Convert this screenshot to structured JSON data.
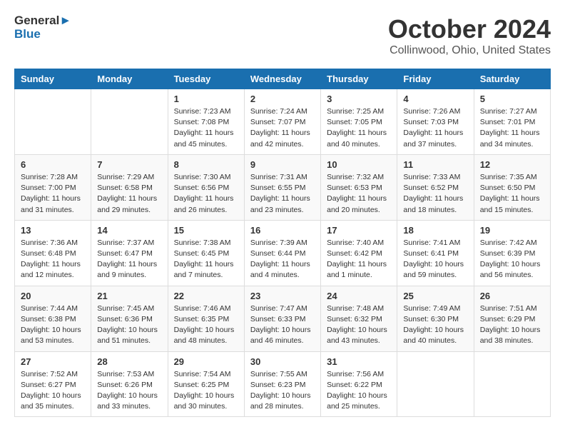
{
  "logo": {
    "line1": "General",
    "line2": "Blue"
  },
  "title": "October 2024",
  "location": "Collinwood, Ohio, United States",
  "headers": [
    "Sunday",
    "Monday",
    "Tuesday",
    "Wednesday",
    "Thursday",
    "Friday",
    "Saturday"
  ],
  "weeks": [
    [
      {
        "day": "",
        "info": ""
      },
      {
        "day": "",
        "info": ""
      },
      {
        "day": "1",
        "info": "Sunrise: 7:23 AM\nSunset: 7:08 PM\nDaylight: 11 hours\nand 45 minutes."
      },
      {
        "day": "2",
        "info": "Sunrise: 7:24 AM\nSunset: 7:07 PM\nDaylight: 11 hours\nand 42 minutes."
      },
      {
        "day": "3",
        "info": "Sunrise: 7:25 AM\nSunset: 7:05 PM\nDaylight: 11 hours\nand 40 minutes."
      },
      {
        "day": "4",
        "info": "Sunrise: 7:26 AM\nSunset: 7:03 PM\nDaylight: 11 hours\nand 37 minutes."
      },
      {
        "day": "5",
        "info": "Sunrise: 7:27 AM\nSunset: 7:01 PM\nDaylight: 11 hours\nand 34 minutes."
      }
    ],
    [
      {
        "day": "6",
        "info": "Sunrise: 7:28 AM\nSunset: 7:00 PM\nDaylight: 11 hours\nand 31 minutes."
      },
      {
        "day": "7",
        "info": "Sunrise: 7:29 AM\nSunset: 6:58 PM\nDaylight: 11 hours\nand 29 minutes."
      },
      {
        "day": "8",
        "info": "Sunrise: 7:30 AM\nSunset: 6:56 PM\nDaylight: 11 hours\nand 26 minutes."
      },
      {
        "day": "9",
        "info": "Sunrise: 7:31 AM\nSunset: 6:55 PM\nDaylight: 11 hours\nand 23 minutes."
      },
      {
        "day": "10",
        "info": "Sunrise: 7:32 AM\nSunset: 6:53 PM\nDaylight: 11 hours\nand 20 minutes."
      },
      {
        "day": "11",
        "info": "Sunrise: 7:33 AM\nSunset: 6:52 PM\nDaylight: 11 hours\nand 18 minutes."
      },
      {
        "day": "12",
        "info": "Sunrise: 7:35 AM\nSunset: 6:50 PM\nDaylight: 11 hours\nand 15 minutes."
      }
    ],
    [
      {
        "day": "13",
        "info": "Sunrise: 7:36 AM\nSunset: 6:48 PM\nDaylight: 11 hours\nand 12 minutes."
      },
      {
        "day": "14",
        "info": "Sunrise: 7:37 AM\nSunset: 6:47 PM\nDaylight: 11 hours\nand 9 minutes."
      },
      {
        "day": "15",
        "info": "Sunrise: 7:38 AM\nSunset: 6:45 PM\nDaylight: 11 hours\nand 7 minutes."
      },
      {
        "day": "16",
        "info": "Sunrise: 7:39 AM\nSunset: 6:44 PM\nDaylight: 11 hours\nand 4 minutes."
      },
      {
        "day": "17",
        "info": "Sunrise: 7:40 AM\nSunset: 6:42 PM\nDaylight: 11 hours\nand 1 minute."
      },
      {
        "day": "18",
        "info": "Sunrise: 7:41 AM\nSunset: 6:41 PM\nDaylight: 10 hours\nand 59 minutes."
      },
      {
        "day": "19",
        "info": "Sunrise: 7:42 AM\nSunset: 6:39 PM\nDaylight: 10 hours\nand 56 minutes."
      }
    ],
    [
      {
        "day": "20",
        "info": "Sunrise: 7:44 AM\nSunset: 6:38 PM\nDaylight: 10 hours\nand 53 minutes."
      },
      {
        "day": "21",
        "info": "Sunrise: 7:45 AM\nSunset: 6:36 PM\nDaylight: 10 hours\nand 51 minutes."
      },
      {
        "day": "22",
        "info": "Sunrise: 7:46 AM\nSunset: 6:35 PM\nDaylight: 10 hours\nand 48 minutes."
      },
      {
        "day": "23",
        "info": "Sunrise: 7:47 AM\nSunset: 6:33 PM\nDaylight: 10 hours\nand 46 minutes."
      },
      {
        "day": "24",
        "info": "Sunrise: 7:48 AM\nSunset: 6:32 PM\nDaylight: 10 hours\nand 43 minutes."
      },
      {
        "day": "25",
        "info": "Sunrise: 7:49 AM\nSunset: 6:30 PM\nDaylight: 10 hours\nand 40 minutes."
      },
      {
        "day": "26",
        "info": "Sunrise: 7:51 AM\nSunset: 6:29 PM\nDaylight: 10 hours\nand 38 minutes."
      }
    ],
    [
      {
        "day": "27",
        "info": "Sunrise: 7:52 AM\nSunset: 6:27 PM\nDaylight: 10 hours\nand 35 minutes."
      },
      {
        "day": "28",
        "info": "Sunrise: 7:53 AM\nSunset: 6:26 PM\nDaylight: 10 hours\nand 33 minutes."
      },
      {
        "day": "29",
        "info": "Sunrise: 7:54 AM\nSunset: 6:25 PM\nDaylight: 10 hours\nand 30 minutes."
      },
      {
        "day": "30",
        "info": "Sunrise: 7:55 AM\nSunset: 6:23 PM\nDaylight: 10 hours\nand 28 minutes."
      },
      {
        "day": "31",
        "info": "Sunrise: 7:56 AM\nSunset: 6:22 PM\nDaylight: 10 hours\nand 25 minutes."
      },
      {
        "day": "",
        "info": ""
      },
      {
        "day": "",
        "info": ""
      }
    ]
  ]
}
